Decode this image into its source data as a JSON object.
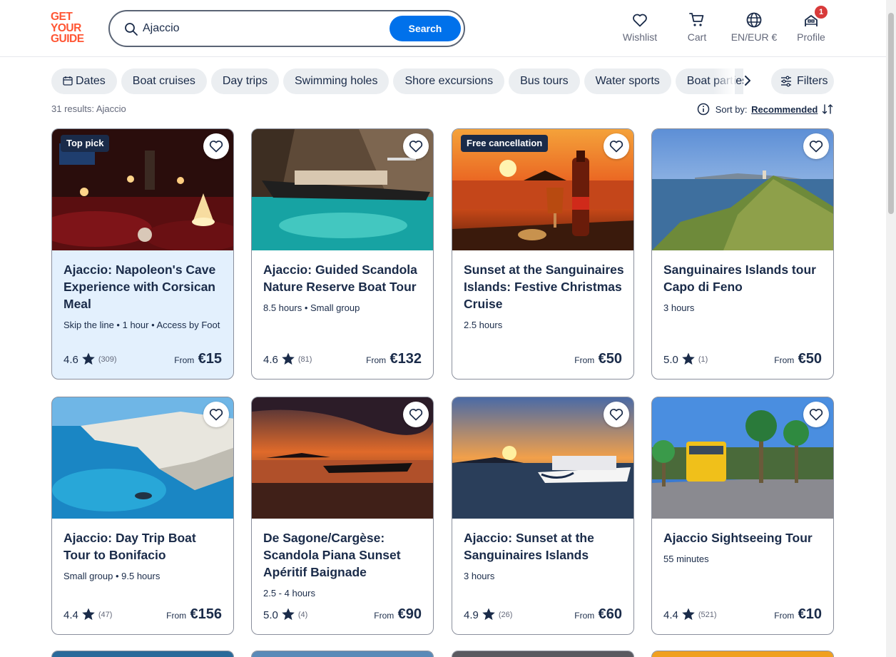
{
  "header": {
    "logo_lines": [
      "GET",
      "YOUR",
      "GUIDE"
    ],
    "search_value": "Ajaccio",
    "search_button": "Search",
    "nav": [
      {
        "label": "Wishlist",
        "icon": "heart-icon"
      },
      {
        "label": "Cart",
        "icon": "cart-icon"
      },
      {
        "label": "EN/EUR €",
        "icon": "globe-icon"
      },
      {
        "label": "Profile",
        "icon": "profile-icon",
        "badge": "1"
      }
    ]
  },
  "chips": [
    "Dates",
    "Boat cruises",
    "Day trips",
    "Swimming holes",
    "Shore excursions",
    "Bus tours",
    "Water sports",
    "Boat parties"
  ],
  "filters_label": "Filters",
  "results_text": "31 results: Ajaccio",
  "sort": {
    "label": "Sort by:",
    "value": "Recommended"
  },
  "cards": [
    {
      "tag": "Top pick",
      "title": "Ajaccio: Napoleon's Cave Experience with Corsican Meal",
      "meta": "Skip the line • 1 hour • Access by Foot",
      "rating": "4.6",
      "reviews": "(309)",
      "from": "From",
      "price": "€15",
      "highlight": true
    },
    {
      "tag": "",
      "title": "Ajaccio: Guided Scandola Nature Reserve Boat Tour",
      "meta": "8.5 hours • Small group",
      "rating": "4.6",
      "reviews": "(81)",
      "from": "From",
      "price": "€132"
    },
    {
      "tag": "Free cancellation",
      "title": "Sunset at the Sanguinaires Islands: Festive Christmas Cruise",
      "meta": "2.5 hours",
      "rating": "",
      "reviews": "",
      "from": "From",
      "price": "€50"
    },
    {
      "tag": "",
      "title": "Sanguinaires Islands tour Capo di Feno",
      "meta": "3 hours",
      "rating": "5.0",
      "reviews": "(1)",
      "from": "From",
      "price": "€50"
    },
    {
      "tag": "",
      "title": "Ajaccio: Day Trip Boat Tour to Bonifacio",
      "meta": "Small group • 9.5 hours",
      "rating": "4.4",
      "reviews": "(47)",
      "from": "From",
      "price": "€156"
    },
    {
      "tag": "",
      "title": "De Sagone/Cargèse: Scandola Piana Sunset Apéritif Baignade",
      "meta": "2.5 - 4 hours",
      "rating": "5.0",
      "reviews": "(4)",
      "from": "From",
      "price": "€90"
    },
    {
      "tag": "",
      "title": "Ajaccio: Sunset at the Sanguinaires Islands",
      "meta": "3 hours",
      "rating": "4.9",
      "reviews": "(26)",
      "from": "From",
      "price": "€60"
    },
    {
      "tag": "",
      "title": "Ajaccio Sightseeing Tour",
      "meta": "55 minutes",
      "rating": "4.4",
      "reviews": "(521)",
      "from": "From",
      "price": "€10"
    }
  ],
  "colors": {
    "brand": "#ff5533",
    "primary": "#0071eb",
    "text": "#1a2b49",
    "highlight_card": "#e3f0fd"
  }
}
